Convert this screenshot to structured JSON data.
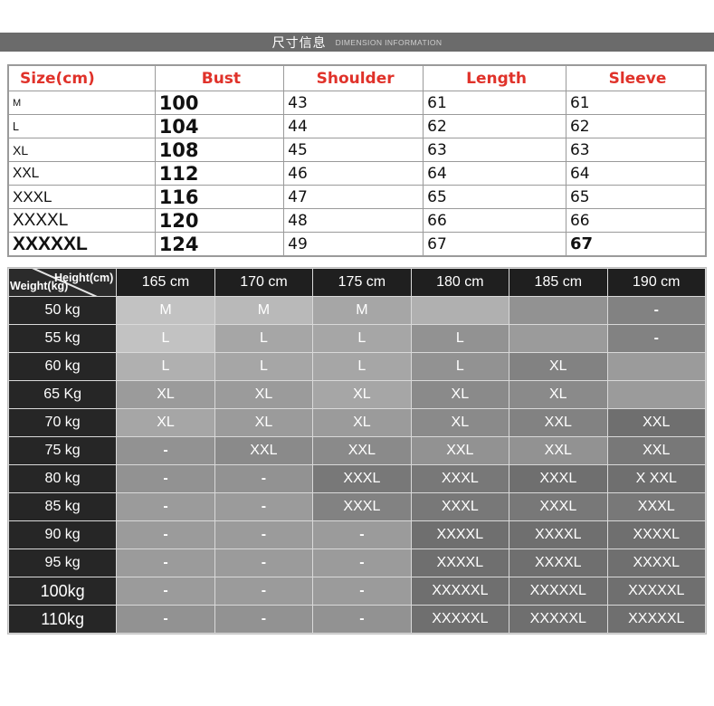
{
  "banner": {
    "title": "尺寸信息",
    "subtitle": "DIMENSION INFORMATION"
  },
  "size_table": {
    "headers": [
      "Size(cm)",
      "Bust",
      "Shoulder",
      "Length",
      "Sleeve"
    ],
    "rows": [
      {
        "size": "M",
        "bust": "100",
        "shoulder": "43",
        "length": "61",
        "sleeve": "61"
      },
      {
        "size": "L",
        "bust": "104",
        "shoulder": "44",
        "length": "62",
        "sleeve": "62"
      },
      {
        "size": "XL",
        "bust": "108",
        "shoulder": "45",
        "length": "63",
        "sleeve": "63"
      },
      {
        "size": "XXL",
        "bust": "112",
        "shoulder": "46",
        "length": "64",
        "sleeve": "64"
      },
      {
        "size": "XXXL",
        "bust": "116",
        "shoulder": "47",
        "length": "65",
        "sleeve": "65"
      },
      {
        "size": "XXXXL",
        "bust": "120",
        "shoulder": "48",
        "length": "66",
        "sleeve": "66"
      },
      {
        "size": "XXXXXL",
        "bust": "124",
        "shoulder": "49",
        "length": "67",
        "sleeve": "67"
      }
    ]
  },
  "matrix_table": {
    "corner": {
      "height_label": "Height(cm)",
      "weight_label": "Weight(kg)"
    },
    "height_headers": [
      "165 cm",
      "170 cm",
      "175 cm",
      "180 cm",
      "185 cm",
      "190 cm"
    ],
    "rows": [
      {
        "weight": "50 kg",
        "values": [
          "M",
          "M",
          "M",
          "",
          "",
          "-"
        ]
      },
      {
        "weight": "55 kg",
        "values": [
          "L",
          "L",
          "L",
          "L",
          "",
          "-"
        ]
      },
      {
        "weight": "60 kg",
        "values": [
          "L",
          "L",
          "L",
          "L",
          "XL",
          ""
        ]
      },
      {
        "weight": "65 Kg",
        "values": [
          "XL",
          "XL",
          "XL",
          "XL",
          "XL",
          ""
        ]
      },
      {
        "weight": "70 kg",
        "values": [
          "XL",
          "XL",
          "XL",
          "XL",
          "XXL",
          "XXL"
        ]
      },
      {
        "weight": "75 kg",
        "values": [
          "-",
          "XXL",
          "XXL",
          "XXL",
          "XXL",
          "XXL"
        ]
      },
      {
        "weight": "80 kg",
        "values": [
          "-",
          "-",
          "XXXL",
          "XXXL",
          "XXXL",
          "X XXL"
        ]
      },
      {
        "weight": "85 kg",
        "values": [
          "-",
          "-",
          "XXXL",
          "XXXL",
          "XXXL",
          "XXXL"
        ]
      },
      {
        "weight": "90 kg",
        "values": [
          "-",
          "-",
          "-",
          "XXXXL",
          "XXXXL",
          "XXXXL"
        ]
      },
      {
        "weight": "95 kg",
        "values": [
          "-",
          "-",
          "-",
          "XXXXL",
          "XXXXL",
          "XXXXL"
        ]
      },
      {
        "weight": "100kg",
        "values": [
          "-",
          "-",
          "-",
          "XXXXXL",
          "XXXXXL",
          "XXXXXL"
        ]
      },
      {
        "weight": "110kg",
        "values": [
          "-",
          "-",
          "-",
          "XXXXXL",
          "XXXXXL",
          "XXXXXL"
        ]
      }
    ],
    "shades": [
      [
        "g1",
        "g2",
        "g4",
        "g3",
        "g6",
        "g8"
      ],
      [
        "g1",
        "g4",
        "g4",
        "g6",
        "g5",
        "g8"
      ],
      [
        "g3",
        "g4",
        "g4",
        "g6",
        "g8",
        "g5"
      ],
      [
        "g5",
        "g5",
        "g4",
        "g7",
        "g7",
        "g5"
      ],
      [
        "g4",
        "g5",
        "g5",
        "g7",
        "g8",
        "g10"
      ],
      [
        "g6",
        "g7",
        "g7",
        "g6",
        "g6",
        "g9"
      ],
      [
        "g6",
        "g6",
        "g9",
        "g9",
        "g10",
        "g10"
      ],
      [
        "g5",
        "g5",
        "g8",
        "g9",
        "g9",
        "g9"
      ],
      [
        "g5",
        "g5",
        "g5",
        "g10",
        "g10",
        "g10"
      ],
      [
        "g5",
        "g5",
        "g5",
        "g10",
        "g10",
        "g10"
      ],
      [
        "g5",
        "g5",
        "g5",
        "g10",
        "g10",
        "g10"
      ],
      [
        "g6",
        "g6",
        "g6",
        "g10",
        "g10",
        "g10"
      ]
    ]
  },
  "colors": {
    "banner_bg": "#6b6b6b",
    "header_red": "#e0322a",
    "matrix_header_bg": "#1f1f1f",
    "row_label_bg": "#262626"
  }
}
